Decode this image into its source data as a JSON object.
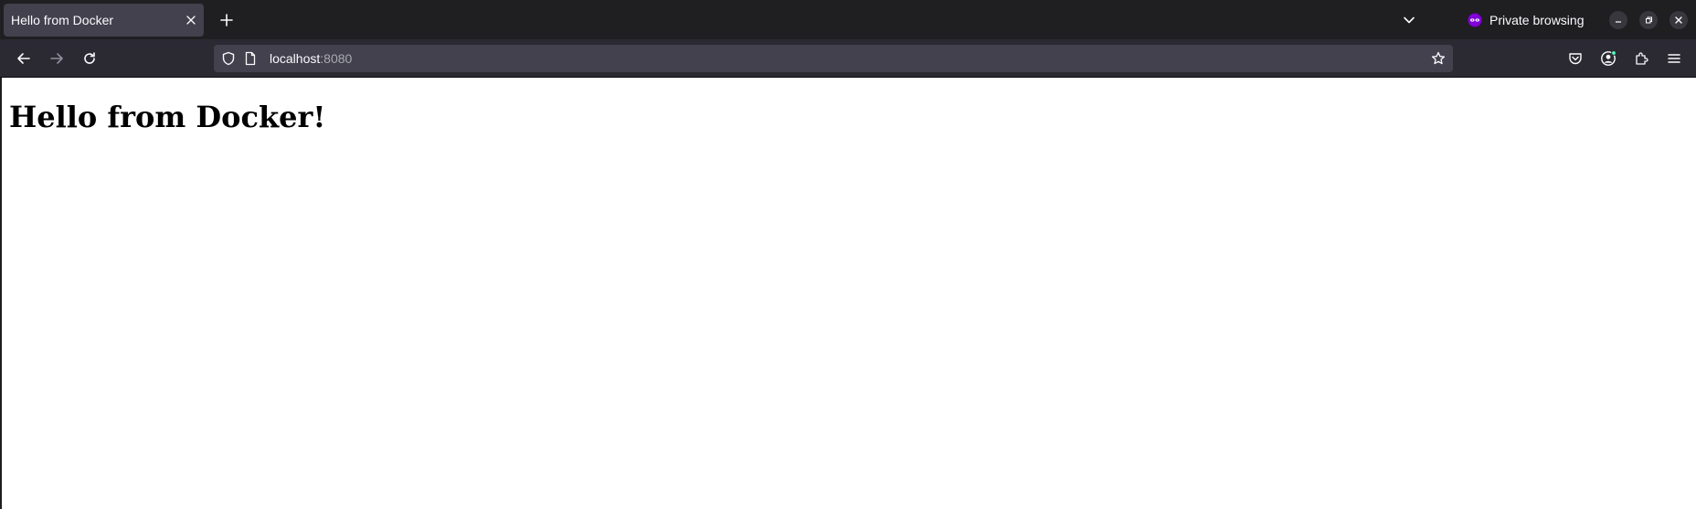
{
  "browser": {
    "tab": {
      "title": "Hello from Docker"
    },
    "private_label": "Private browsing",
    "url": {
      "host": "localhost",
      "port": ":8080"
    },
    "icons": {
      "tab_close": "close-icon",
      "new_tab": "plus-icon",
      "list_tabs": "chevron-down-icon",
      "private": "private-mask-icon",
      "back": "arrow-left-icon",
      "forward": "arrow-right-icon",
      "reload": "reload-icon",
      "shield": "shield-icon",
      "page": "page-icon",
      "bookmark": "star-icon",
      "pocket": "pocket-icon",
      "account": "account-icon",
      "extensions": "puzzle-icon",
      "menu": "hamburger-menu-icon",
      "minimize": "minimize-icon",
      "restore": "restore-icon",
      "close_window": "close-window-icon"
    },
    "colors": {
      "tabstrip_bg": "#1f1e21",
      "navbar_bg": "#2b2a33",
      "urlbar_bg": "#42414d",
      "private_accent": "#8000d7",
      "notification_dot": "#54ffbd"
    }
  },
  "page": {
    "heading": "Hello from Docker!"
  }
}
